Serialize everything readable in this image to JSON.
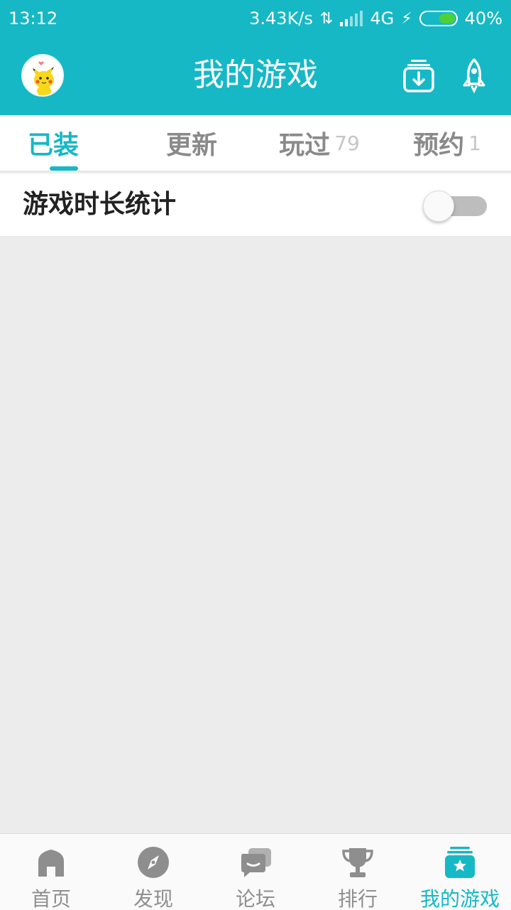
{
  "status_bar": {
    "time": "13:12",
    "net_speed": "3.43K/s",
    "network": "4G",
    "battery": "40%",
    "battery_level": 0.4
  },
  "header": {
    "title": "我的游戏",
    "accent_color": "#16b8c6"
  },
  "tabs": [
    {
      "label": "已装",
      "count": "",
      "active": true
    },
    {
      "label": "更新",
      "count": ""
    },
    {
      "label": "玩过",
      "count": "79"
    },
    {
      "label": "预约",
      "count": "1"
    }
  ],
  "setting": {
    "label": "游戏时长统计",
    "enabled": false
  },
  "bottom_nav": [
    {
      "label": "首页",
      "icon": "home-icon"
    },
    {
      "label": "发现",
      "icon": "compass-icon"
    },
    {
      "label": "论坛",
      "icon": "forum-icon"
    },
    {
      "label": "排行",
      "icon": "trophy-icon"
    },
    {
      "label": "我的游戏",
      "icon": "my-games-icon",
      "active": true
    }
  ]
}
